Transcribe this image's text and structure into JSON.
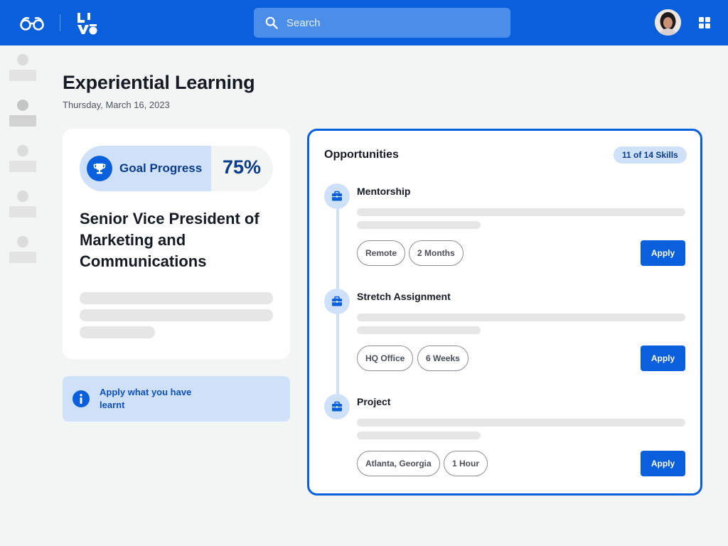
{
  "header": {
    "search_placeholder": "Search",
    "brand_color": "#0a5fdc"
  },
  "icons": {
    "logo": "glasses-logo-icon",
    "brand": "live-logo-icon",
    "search": "search-icon",
    "apps": "grid-apps-icon",
    "trophy": "trophy-icon",
    "info": "info-icon",
    "opportunity": "briefcase-icon"
  },
  "page": {
    "title": "Experiential Learning",
    "date": "Thursday, March 16, 2023"
  },
  "goal": {
    "label": "Goal Progress",
    "percent": "75%",
    "role": "Senior Vice President of Marketing and Communications"
  },
  "info_banner": {
    "text": "Apply what you have learnt"
  },
  "opportunities": {
    "title": "Opportunities",
    "skills_badge": "11 of 14 Skills",
    "items": [
      {
        "name": "Mentorship",
        "tags": [
          "Remote",
          "2 Months"
        ],
        "action": "Apply"
      },
      {
        "name": "Stretch Assignment",
        "tags": [
          "HQ Office",
          "6 Weeks"
        ],
        "action": "Apply"
      },
      {
        "name": "Project",
        "tags": [
          "Atlanta, Georgia",
          "1 Hour"
        ],
        "action": "Apply"
      }
    ]
  }
}
